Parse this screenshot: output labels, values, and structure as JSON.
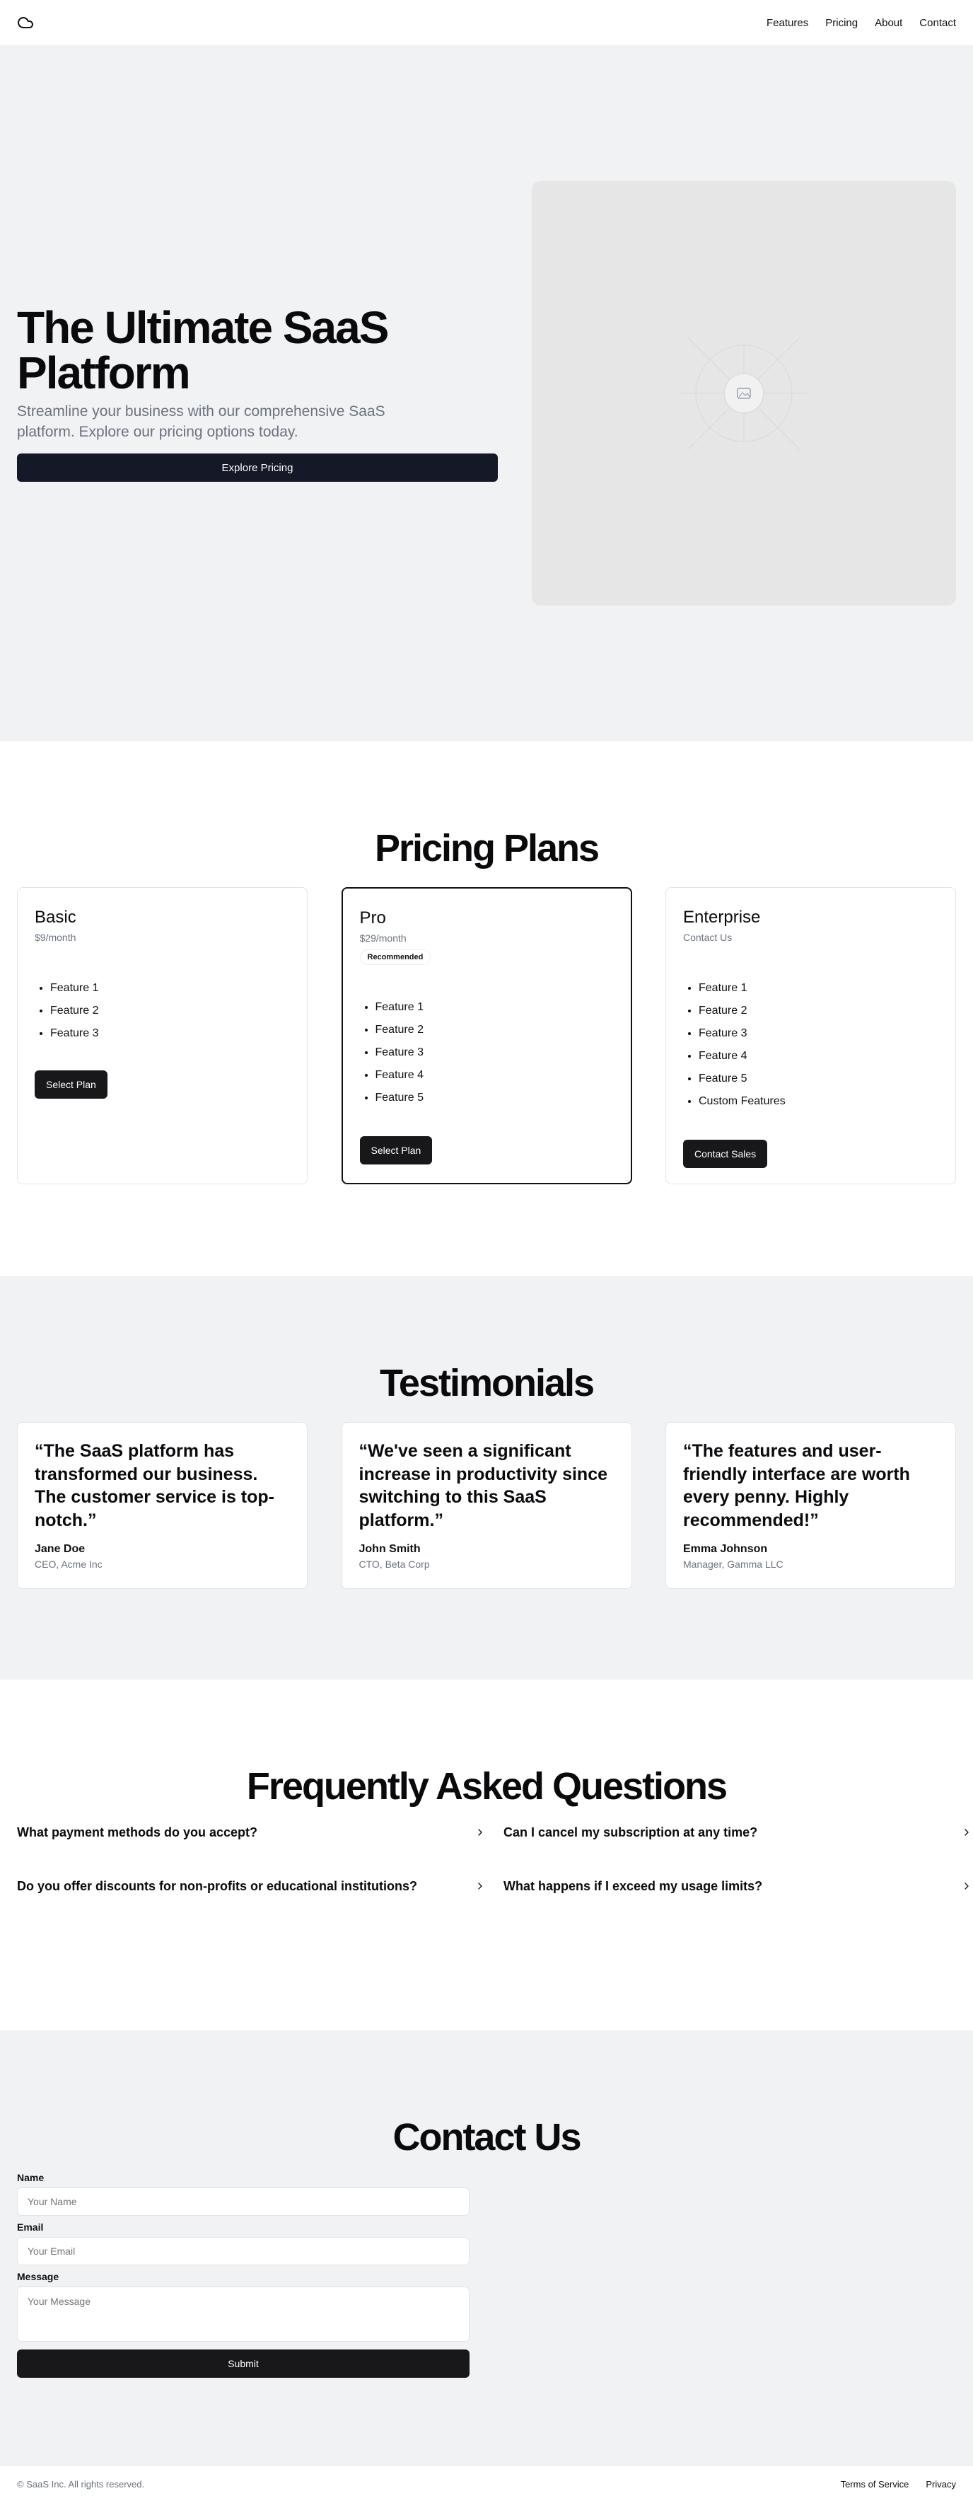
{
  "header": {
    "logo_icon": "cloud-icon",
    "nav": [
      "Features",
      "Pricing",
      "About",
      "Contact"
    ]
  },
  "hero": {
    "title": "The Ultimate SaaS Platform",
    "subtitle": "Streamline your business with our comprehensive SaaS platform. Explore our pricing options today.",
    "button": "Explore Pricing",
    "image_icon": "image-placeholder-icon"
  },
  "pricing": {
    "title": "Pricing Plans",
    "plans": [
      {
        "name": "Basic",
        "price": "$9/month",
        "features": [
          "Feature 1",
          "Feature 2",
          "Feature 3"
        ],
        "button": "Select Plan"
      },
      {
        "name": "Pro",
        "price": "$29/month",
        "badge": "Recommended",
        "features": [
          "Feature 1",
          "Feature 2",
          "Feature 3",
          "Feature 4",
          "Feature 5"
        ],
        "button": "Select Plan"
      },
      {
        "name": "Enterprise",
        "price": "Contact Us",
        "features": [
          "Feature 1",
          "Feature 2",
          "Feature 3",
          "Feature 4",
          "Feature 5",
          "Custom Features"
        ],
        "button": "Contact Sales"
      }
    ]
  },
  "testimonials": {
    "title": "Testimonials",
    "items": [
      {
        "quote": "“The SaaS platform has transformed our business. The customer service is top-notch.”",
        "name": "Jane Doe",
        "role": "CEO, Acme Inc"
      },
      {
        "quote": "“We've seen a significant increase in productivity since switching to this SaaS platform.”",
        "name": "John Smith",
        "role": "CTO, Beta Corp"
      },
      {
        "quote": "“The features and user-friendly interface are worth every penny. Highly recommended!”",
        "name": "Emma Johnson",
        "role": "Manager, Gamma LLC"
      }
    ]
  },
  "faq": {
    "title": "Frequently Asked Questions",
    "items": [
      "What payment methods do you accept?",
      "Can I cancel my subscription at any time?",
      "Do you offer discounts for non-profits or educational institutions?",
      "What happens if I exceed my usage limits?"
    ]
  },
  "contact": {
    "title": "Contact Us",
    "name_label": "Name",
    "name_placeholder": "Your Name",
    "email_label": "Email",
    "email_placeholder": "Your Email",
    "message_label": "Message",
    "message_placeholder": "Your Message",
    "submit": "Submit"
  },
  "footer": {
    "copyright": "© SaaS Inc. All rights reserved.",
    "links": [
      "Terms of Service",
      "Privacy"
    ]
  }
}
